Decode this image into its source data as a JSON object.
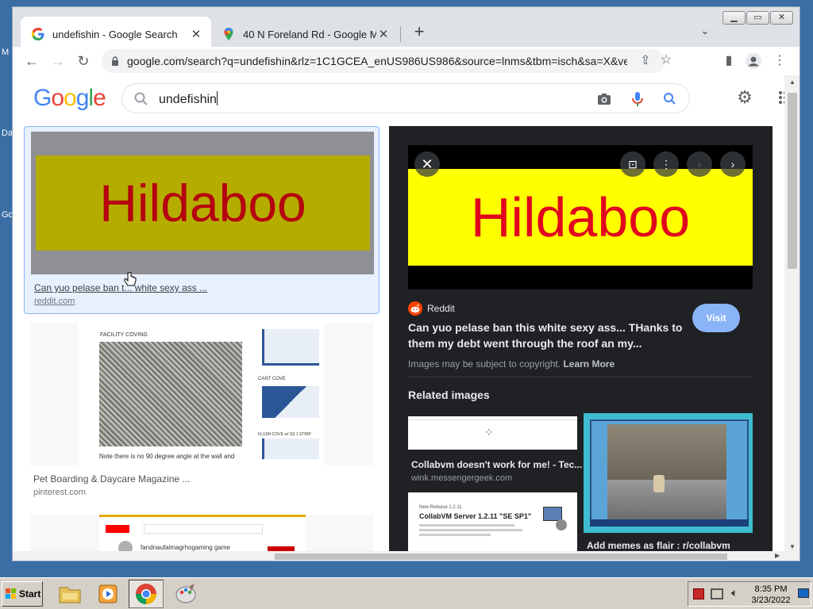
{
  "desktop": {
    "labels": [
      "M",
      "Da",
      "Go"
    ]
  },
  "browser": {
    "tabs": [
      {
        "label": "undefishin - Google Search",
        "active": true
      },
      {
        "label": "40 N Foreland Rd - Google Maps",
        "active": false
      }
    ],
    "address": "google.com/search?q=undefishin&rlz=1C1GCEA_enUS986US986&source=lnms&tbm=isch&sa=X&ved=2a..."
  },
  "google": {
    "logo": "Google",
    "query": "undefishin"
  },
  "results": [
    {
      "title": "Can yuo pelase ban t... white sexy ass ...",
      "source": "reddit.com",
      "thumb_text": "Hildaboo",
      "selected": true
    },
    {
      "title": "Pet Boarding & Daycare Magazine ...",
      "source": "pinterest.com",
      "thumb_labels": [
        "FACILITY COVING",
        "CANT COVE",
        "FLUSH COVE w/ SS 1 STRIP",
        "Note there is no 90 degree angle at the wall and"
      ]
    },
    {
      "title": "",
      "source": "",
      "thumb_labels": [
        "fandnaufalmagrhogaming game"
      ]
    }
  ],
  "preview": {
    "image_text": "Hildaboo",
    "site": "Reddit",
    "visit_label": "Visit",
    "title": "Can yuo pelase ban this white sexy ass... THanks to them my debt went through the roof an my...",
    "copyright": "Images may be subject to copyright.",
    "learn_more": "Learn More",
    "related_heading": "Related images",
    "related": [
      {
        "title": "Collabvm doesn't work for me! - Tec...",
        "source": "wink.messengergeek.com"
      },
      {
        "title": "Add memes as flair : r/collabvm",
        "source": ""
      },
      {
        "title": "",
        "source": "",
        "thumb_labels": [
          "New Release 1.2.11",
          "CollabVM Server 1.2.11 \"SE SP1\""
        ]
      }
    ]
  },
  "taskbar": {
    "start_label": "Start",
    "time": "8:35 PM",
    "date": "3/23/2022"
  },
  "colors": {
    "google_blue": "#4285f4",
    "google_red": "#ea4335",
    "google_yellow": "#fbbc05",
    "google_green": "#34a853",
    "panel_bg": "#202124",
    "visit_blue": "#8ab4f8",
    "hildaboo_red": "#e0061e",
    "hildaboo_yellow": "#ffff00"
  }
}
